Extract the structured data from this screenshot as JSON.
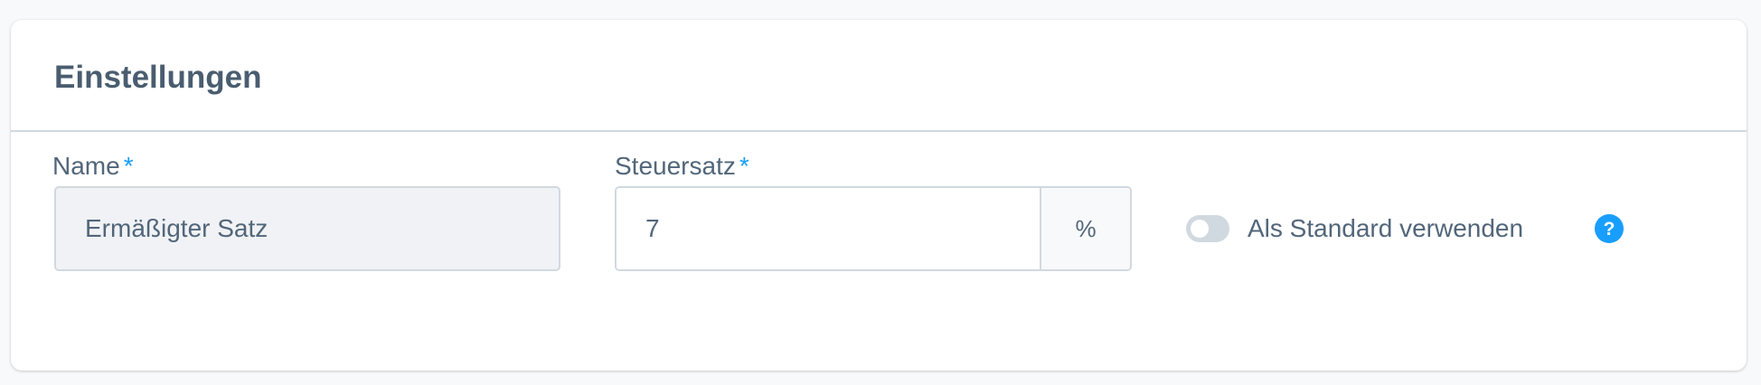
{
  "card": {
    "title": "Einstellungen"
  },
  "name_field": {
    "label": "Name",
    "required_mark": "*",
    "value": "Ermäßigter Satz"
  },
  "tax_field": {
    "label": "Steuersatz",
    "required_mark": "*",
    "value": "7",
    "suffix": "%"
  },
  "default_toggle": {
    "label": "Als Standard verwenden",
    "checked": false
  },
  "help": {
    "icon": "question-circle-icon",
    "glyph": "?"
  },
  "colors": {
    "accent": "#189eff",
    "border": "#d1d9e0",
    "text": "#52667a",
    "disabled_bg": "#f0f2f5"
  }
}
